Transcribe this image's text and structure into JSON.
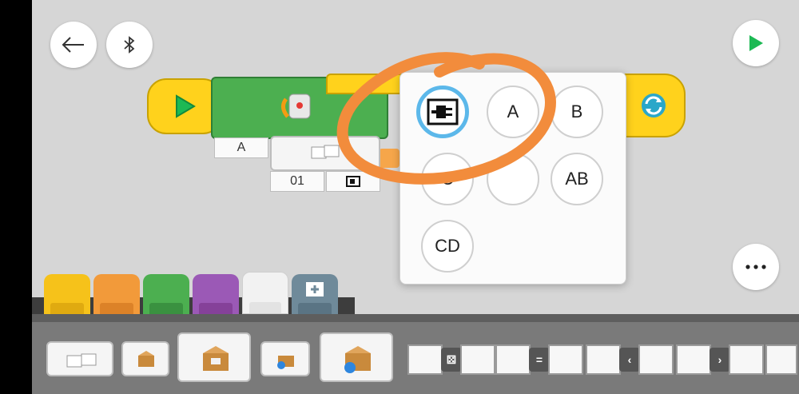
{
  "toolbar": {
    "back_icon": "back-arrow-icon",
    "bluetooth_icon": "bluetooth-icon",
    "play_icon": "play-icon",
    "more_icon": "more-dots-icon"
  },
  "program": {
    "motor_port_label": "A",
    "sensor_value": "01",
    "loop_icon": "loop-arrows-icon"
  },
  "port_popup": {
    "ports": [
      "A",
      "B",
      "C",
      "AB",
      "CD"
    ],
    "selected": "plug-icon"
  },
  "palette_tabs": [
    {
      "name": "yellow",
      "color": "#f6c21a"
    },
    {
      "name": "orange",
      "color": "#f29a3a"
    },
    {
      "name": "green",
      "color": "#4caf50"
    },
    {
      "name": "purple",
      "color": "#9b59b6"
    },
    {
      "name": "white",
      "color": "#f2f2f2"
    },
    {
      "name": "slate",
      "color": "#6f8a9a"
    }
  ],
  "colors": {
    "canvas": "#d6d6d6",
    "annotation": "#f28c3c",
    "selected_ring": "#5cb8ea",
    "play_green": "#1db954"
  }
}
